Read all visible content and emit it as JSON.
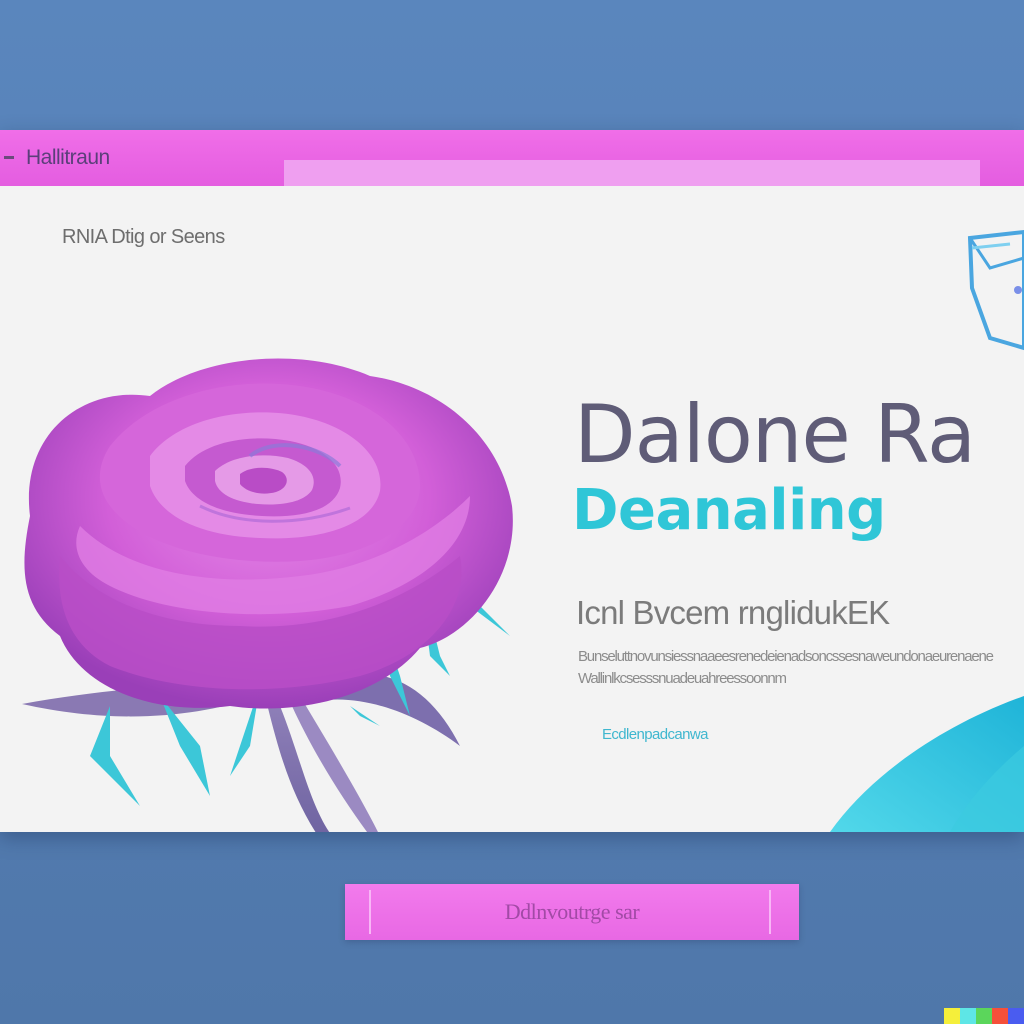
{
  "window": {
    "title": "Hallitraun"
  },
  "content": {
    "breadcrumb": "RNIA Dtig or Seens",
    "headline": "Dalone Ra",
    "subheadline": "Deanaling",
    "tagline": "Icnl Bvcem rnglidukEK",
    "body_lines": [
      "Bunseluttnovunsiessnaaeesrenedeienadsoncssesnaweundonaeurenaene",
      "Wallinlkcsesssnuadeuahreessoonnm"
    ],
    "link_text": "Ecdlenpadcanwa"
  },
  "action_button": {
    "label": "Ddlnvoutrge sar"
  },
  "colors": {
    "background": "#5680b5",
    "title_bar": "#e864e4",
    "headline": "#5f5c77",
    "accent_cyan": "#2fc6d7",
    "rose_pink": "#d35bd6",
    "button": "#ec70e8"
  },
  "icons": {
    "corner_graphic": "gem-outline-icon",
    "rose_image": "rose-illustration"
  },
  "watermark_colors": [
    "#f5ef3a",
    "#5ee6e6",
    "#5bd65b",
    "#f5503a",
    "#4a5cf0"
  ]
}
